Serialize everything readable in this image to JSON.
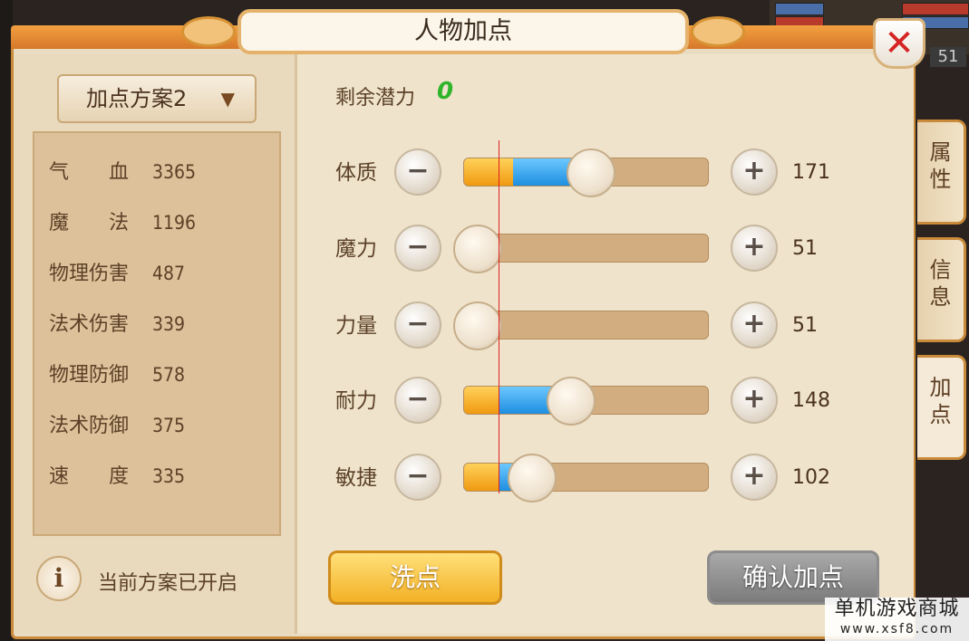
{
  "window": {
    "title": "人物加点",
    "close_symbol": "✕"
  },
  "hud": {
    "level": "51"
  },
  "plan": {
    "selected": "加点方案2"
  },
  "stats": [
    {
      "label": "气　　血",
      "value": "3365"
    },
    {
      "label": "魔　　法",
      "value": "1196"
    },
    {
      "label": "物理伤害",
      "value": "487"
    },
    {
      "label": "法术伤害",
      "value": "339"
    },
    {
      "label": "物理防御",
      "value": "578"
    },
    {
      "label": "法术防御",
      "value": "375"
    },
    {
      "label": "速　　度",
      "value": "335"
    }
  ],
  "status": {
    "info_glyph": "i",
    "text": "当前方案已开启"
  },
  "potential": {
    "label": "剩余潜力",
    "value": "0"
  },
  "attributes": [
    {
      "label": "体质",
      "value": "171",
      "base_fraction": 0.2,
      "total_fraction": 0.52
    },
    {
      "label": "魔力",
      "value": "51",
      "base_fraction": 0.06,
      "total_fraction": 0.06
    },
    {
      "label": "力量",
      "value": "51",
      "base_fraction": 0.06,
      "total_fraction": 0.06
    },
    {
      "label": "耐力",
      "value": "148",
      "base_fraction": 0.14,
      "total_fraction": 0.44
    },
    {
      "label": "敏捷",
      "value": "102",
      "base_fraction": 0.14,
      "total_fraction": 0.28
    }
  ],
  "buttons": {
    "minus": "−",
    "plus": "+",
    "reset": "洗点",
    "confirm": "确认加点"
  },
  "side_tabs": [
    {
      "label": "属\n性",
      "active": false
    },
    {
      "label": "信\n息",
      "active": false
    },
    {
      "label": "加\n点",
      "active": true
    }
  ],
  "watermark": {
    "line1": "单机游戏商城",
    "line2": "www.xsf8.com"
  },
  "colors": {
    "potential": "#2fb42a",
    "fill_base": "#f09a10",
    "fill_added": "#1e8ee0",
    "close": "#d42424"
  }
}
